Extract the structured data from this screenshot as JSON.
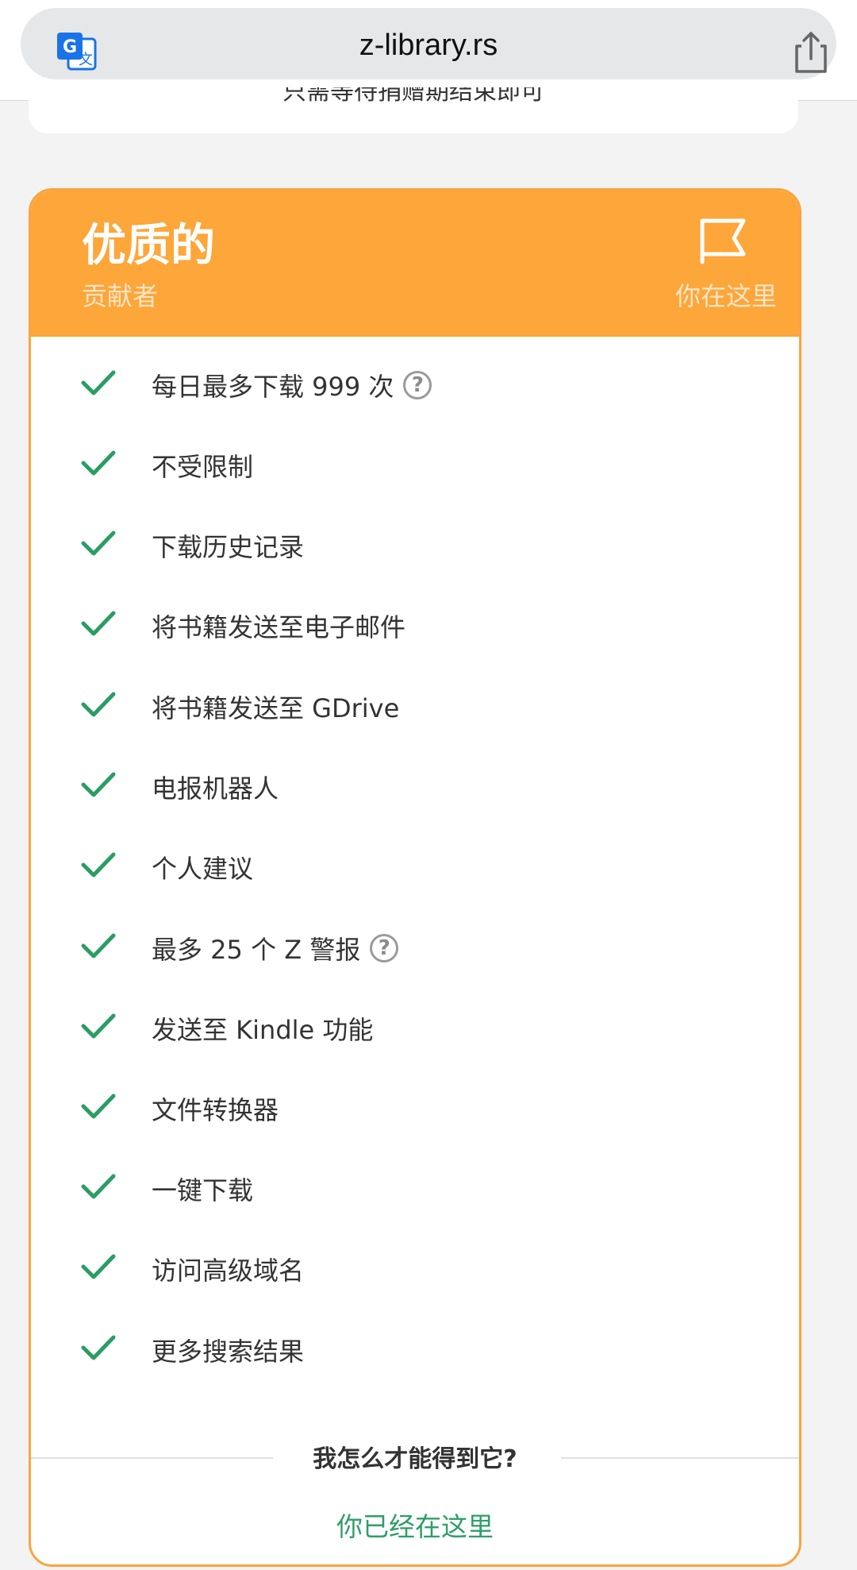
{
  "browser": {
    "url": "z-library.rs",
    "icons": {
      "translate": "translate-icon",
      "share": "share-icon"
    }
  },
  "prev_card": {
    "text": "只需等待捐赠期结束即可"
  },
  "plan": {
    "title": "优质的",
    "subtitle": "贡献者",
    "current_label": "你在这里",
    "header_color": "#fda63a",
    "border_color": "#f9a440",
    "icons": {
      "flag": "flag-icon",
      "check": "check-icon",
      "help": "help-icon"
    },
    "features": [
      {
        "text": "每日最多下载 999 次",
        "help": true
      },
      {
        "text": "不受限制",
        "help": false
      },
      {
        "text": "下载历史记录",
        "help": false
      },
      {
        "text": "将书籍发送至电子邮件",
        "help": false
      },
      {
        "text": "将书籍发送至 GDrive",
        "help": false
      },
      {
        "text": "电报机器人",
        "help": false
      },
      {
        "text": "个人建议",
        "help": false
      },
      {
        "text": "最多 25 个 Z 警报",
        "help": true
      },
      {
        "text": "发送至 Kindle 功能",
        "help": false
      },
      {
        "text": "文件转换器",
        "help": false
      },
      {
        "text": "一键下载",
        "help": false
      },
      {
        "text": "访问高级域名",
        "help": false
      },
      {
        "text": "更多搜索结果",
        "help": false
      }
    ],
    "help_glyph": "?",
    "howto": "我怎么才能得到它?",
    "status_link": "你已经在这里",
    "check_color": "#2a9d63",
    "link_color": "#2f9e68"
  }
}
